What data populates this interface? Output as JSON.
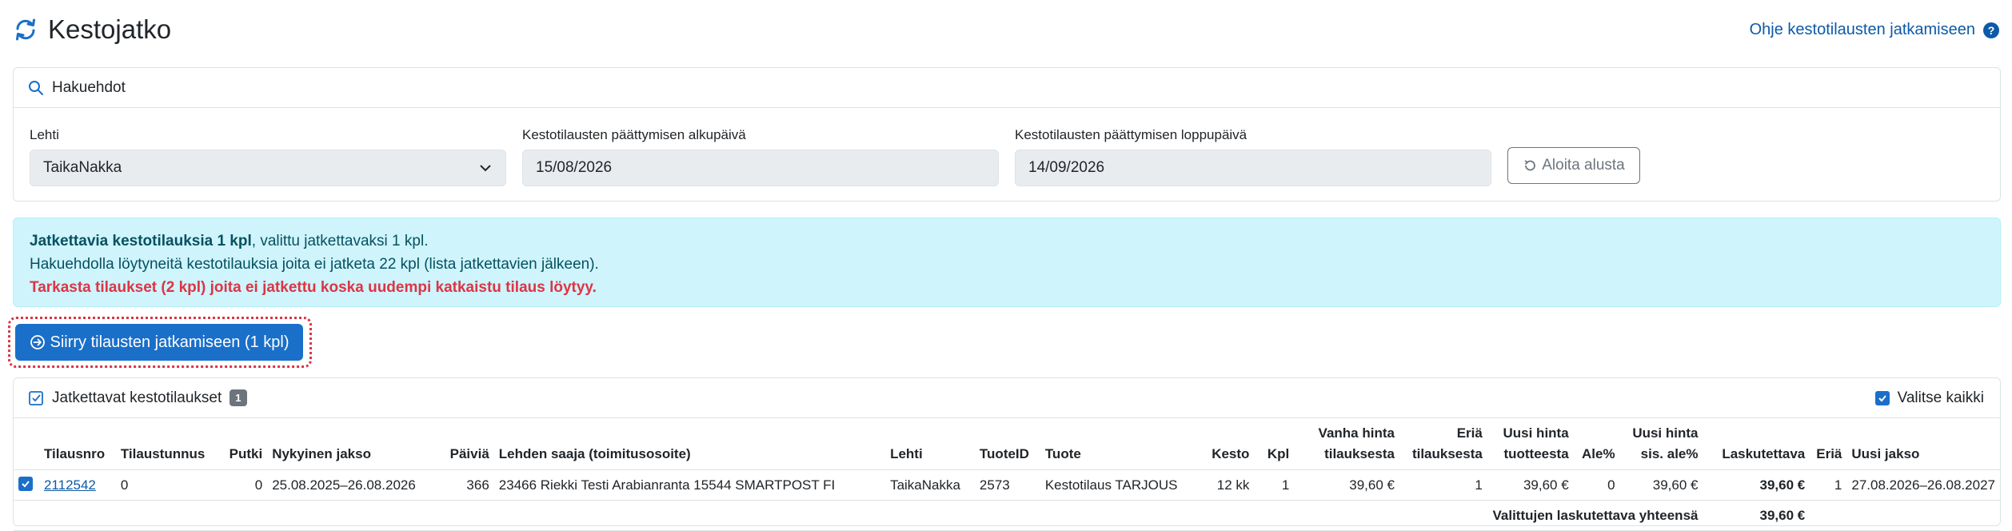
{
  "header": {
    "title": "Kestojatko",
    "help_link": "Ohje kestotilausten jatkamiseen",
    "help_icon": "?"
  },
  "search": {
    "title": "Hakuehdot",
    "lehti_label": "Lehti",
    "lehti_value": "TaikaNakka",
    "start_label": "Kestotilausten päättymisen alkupäivä",
    "start_value": "15/08/2026",
    "end_label": "Kestotilausten päättymisen loppupäivä",
    "end_value": "14/09/2026",
    "reset_label": "Aloita alusta"
  },
  "alert": {
    "line1_bold": "Jatkettavia kestotilauksia 1 kpl",
    "line1_rest": ", valittu jatkettavaksi 1 kpl.",
    "line2": "Hakuehdolla löytyneitä kestotilauksia joita ei jatketa 22 kpl (lista jatkettavien jälkeen).",
    "line3": "Tarkasta tilaukset (2 kpl) joita ei jatkettu koska uudempi katkaistu tilaus löytyy."
  },
  "action": {
    "button_label": "Siirry tilausten jatkamiseen (1 kpl)"
  },
  "table_card": {
    "title": "Jatkettavat kestotilaukset",
    "count": "1",
    "select_all": "Valitse kaikki",
    "headers": {
      "tilausnro": "Tilausnro",
      "tilaustunnus": "Tilaustunnus",
      "putki": "Putki",
      "nykyinen_jakso": "Nykyinen jakso",
      "paivia": "Päiviä",
      "saaja": "Lehden saaja (toimitusosoite)",
      "lehti": "Lehti",
      "tuoteid": "TuoteID",
      "tuote": "Tuote",
      "kesto": "Kesto",
      "kpl": "Kpl",
      "vanha_hinta_1": "Vanha hinta",
      "vanha_hinta_2": "tilauksesta",
      "eria_1": "Eriä",
      "eria_2": "tilauksesta",
      "uusi_hinta_1": "Uusi hinta",
      "uusi_hinta_2": "tuotteesta",
      "ale": "Ale%",
      "uusi_sis_1": "Uusi hinta",
      "uusi_sis_2": "sis. ale%",
      "laskutettava": "Laskutettava",
      "eria": "Eriä",
      "uusi_jakso": "Uusi jakso"
    },
    "row": {
      "tilausnro": "2112542",
      "tilaustunnus": "0",
      "putki": "0",
      "nykyinen_jakso": "25.08.2025–26.08.2026",
      "paivia": "366",
      "saaja": "23466 Riekki Testi Arabianranta 15544 SMARTPOST FI",
      "lehti": "TaikaNakka",
      "tuoteid": "2573",
      "tuote": "Kestotilaus TARJOUS",
      "kesto": "12 kk",
      "kpl": "1",
      "vanha_hinta": "39,60 €",
      "eria_tilauksesta": "1",
      "uusi_hinta": "39,60 €",
      "ale": "0",
      "uusi_sis": "39,60 €",
      "laskutettava": "39,60 €",
      "eria": "1",
      "uusi_jakso": "27.08.2026–26.08.2027"
    },
    "total_label": "Valittujen laskutettava yhteensä",
    "total_value": "39,60 €"
  }
}
